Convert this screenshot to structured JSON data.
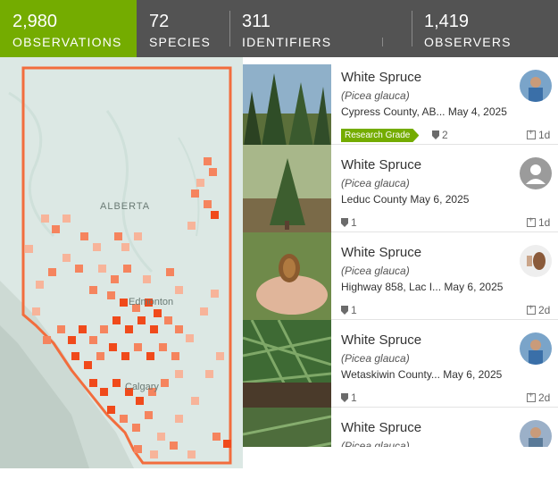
{
  "stats": [
    {
      "count": "2,980",
      "label": "OBSERVATIONS",
      "active": true
    },
    {
      "count": "72",
      "label": "SPECIES",
      "active": false
    },
    {
      "count": "311",
      "label": "IDENTIFIERS",
      "active": false
    },
    {
      "count": "1,419",
      "label": "OBSERVERS",
      "active": false
    }
  ],
  "map": {
    "labels": [
      {
        "text": "ALBERTA"
      },
      {
        "text": "Edmonton"
      },
      {
        "text": "Calgary"
      }
    ],
    "colors": {
      "outline": "#f26d3d",
      "heat_light": "#f7b49a",
      "heat_mid": "#f5845e",
      "heat_dark": "#f04a1b",
      "land": "#dce8e4",
      "terrain": "#c9d6d0"
    }
  },
  "observations": [
    {
      "title": "White Spruce",
      "sci": "(Picea glauca)",
      "place": "Cypress County, AB... May 4, 2025",
      "grade": "Research Grade",
      "ids": "2",
      "age": "1d",
      "avatar": "photo"
    },
    {
      "title": "White Spruce",
      "sci": "(Picea glauca)",
      "place": "Leduc County May 6, 2025",
      "grade": "",
      "ids": "1",
      "age": "1d",
      "avatar": "default-user-icon"
    },
    {
      "title": "White Spruce",
      "sci": "(Picea glauca)",
      "place": "Highway 858, Lac I... May 6, 2025",
      "grade": "",
      "ids": "1",
      "age": "2d",
      "avatar": "photo"
    },
    {
      "title": "White Spruce",
      "sci": "(Picea glauca)",
      "place": "Wetaskiwin County... May 6, 2025",
      "grade": "",
      "ids": "1",
      "age": "2d",
      "avatar": "photo"
    },
    {
      "title": "White Spruce",
      "sci": "(Picea glauca)",
      "place": "",
      "grade": "",
      "ids": "",
      "age": "",
      "avatar": "photo"
    }
  ],
  "accent": "#74ac00",
  "header_bg": "#535353"
}
